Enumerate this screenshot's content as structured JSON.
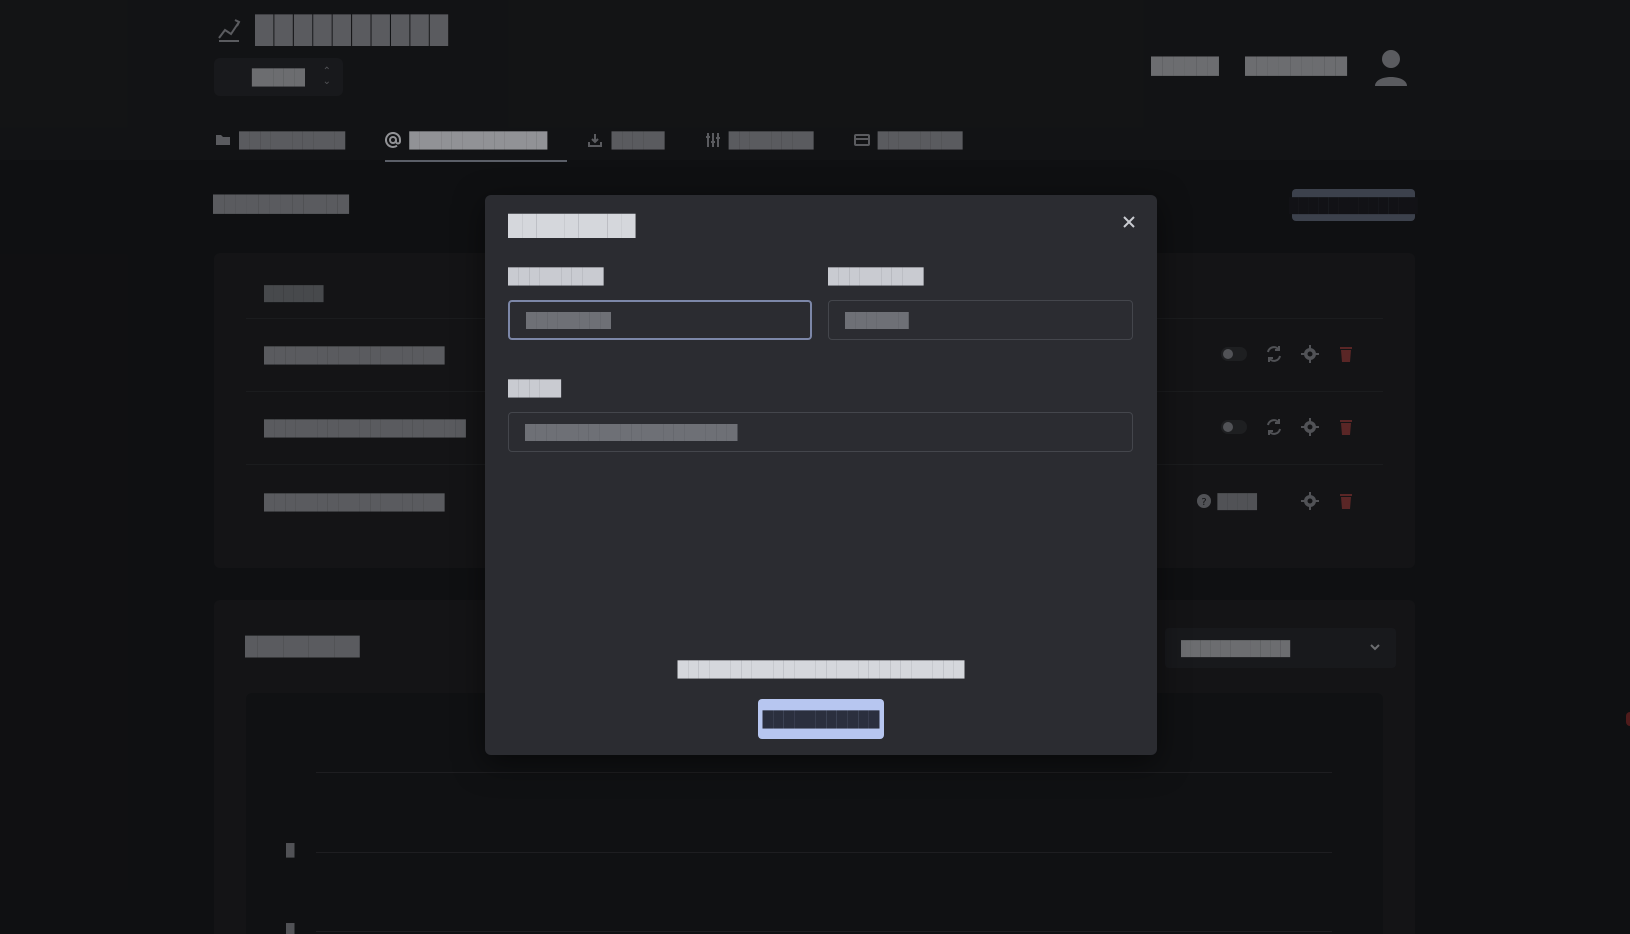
{
  "header": {
    "app_title": "██████████",
    "selector_value": "█████",
    "links": [
      "██████",
      "█████████"
    ]
  },
  "tabs": [
    {
      "label": "██████████",
      "icon": "folder-icon"
    },
    {
      "label": "█████████████",
      "icon": "at-icon",
      "active": true
    },
    {
      "label": "█████",
      "icon": "download-icon"
    },
    {
      "label": "████████",
      "icon": "sliders-icon"
    },
    {
      "label": "████████",
      "icon": "card-icon"
    }
  ],
  "main": {
    "section_title": "████████████",
    "add_button": "█████████████",
    "table": {
      "column_header": "██████",
      "rows": [
        {
          "name": "█████████████████",
          "status": "toggle"
        },
        {
          "name": "███████████████████",
          "status": "toggle"
        },
        {
          "name": "█████████████████",
          "status": "help",
          "help_text": "████"
        }
      ]
    },
    "stats": {
      "title": "█████████",
      "range_select": "███████████",
      "y_ticks": [
        "█",
        "█"
      ]
    }
  },
  "modal": {
    "title": "█████████",
    "field1_label": "█████████",
    "field1_placeholder": "████████",
    "field2_label": "█████████",
    "field2_placeholder": "██████",
    "field3_label": "█████",
    "field3_placeholder": "████████████████████",
    "footer_text": "███████████████████████████",
    "confirm_button": "███████████"
  },
  "colors": {
    "accent": "#b7c6f0",
    "danger": "#8a3b3b",
    "background": "#18191c"
  }
}
